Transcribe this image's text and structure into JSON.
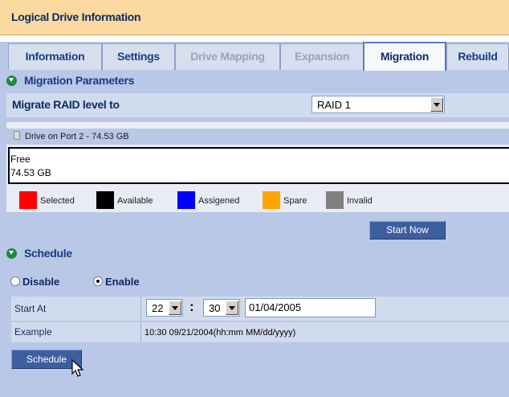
{
  "page_title": "Logical Drive Information",
  "tabs": [
    {
      "label": "Information",
      "state": "normal"
    },
    {
      "label": "Settings",
      "state": "normal"
    },
    {
      "label": "Drive Mapping",
      "state": "disabled"
    },
    {
      "label": "Expansion",
      "state": "disabled"
    },
    {
      "label": "Migration",
      "state": "active"
    },
    {
      "label": "Rebuild",
      "state": "normal"
    }
  ],
  "migration": {
    "section_title": "Migration Parameters",
    "raid_label": "Migrate RAID level to",
    "raid_value": "RAID 1",
    "drive_label": "Drive on Port 2 - 74.53 GB",
    "free_label": "Free",
    "free_size": "74.53 GB",
    "legend": [
      {
        "label": "Selected",
        "color": "#ff0000"
      },
      {
        "label": "Available",
        "color": "#000000"
      },
      {
        "label": "Assigened",
        "color": "#0000ff"
      },
      {
        "label": "Spare",
        "color": "#ffa500"
      },
      {
        "label": "Invalid",
        "color": "#808080"
      }
    ],
    "start_now_label": "Start Now"
  },
  "schedule": {
    "section_title": "Schedule",
    "disable_label": "Disable",
    "enable_label": "Enable",
    "selected": "Enable",
    "start_at_label": "Start At",
    "hour": "22",
    "minute": "30",
    "colon": ":",
    "date": "01/04/2005",
    "example_label": "Example",
    "example_value": "10:30 09/21/2004(hh:mm MM/dd/yyyy)",
    "button_label": "Schedule"
  },
  "colors": {
    "title_bg": "#fbd9a0",
    "panel_bg": "#b9c8e6",
    "button_bg": "#3e5f9f",
    "label_color": "#0d2a63"
  }
}
